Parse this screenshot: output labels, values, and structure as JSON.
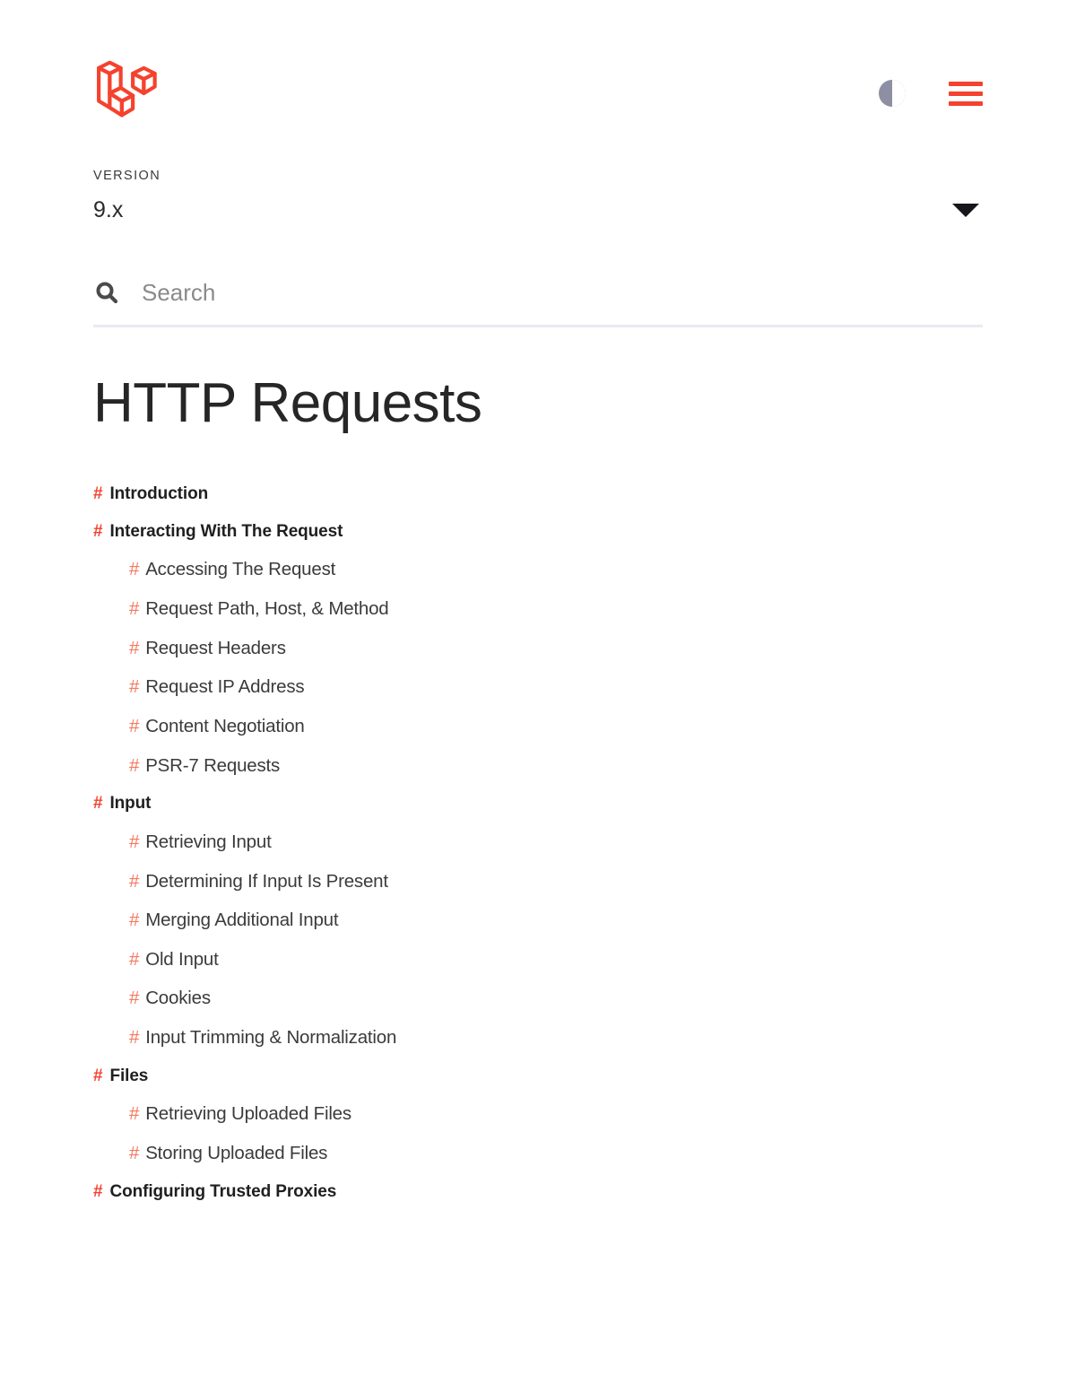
{
  "header": {
    "logo_name": "laravel-logo",
    "logo_color": "#f4422e",
    "dark_mode_toggle_name": "contrast-icon",
    "menu_toggle_name": "hamburger-menu-icon",
    "accent_color": "#f4422e"
  },
  "version": {
    "label": "VERSION",
    "selected": "9.x",
    "caret_name": "chevron-down-icon"
  },
  "search": {
    "placeholder": "Search",
    "value": "",
    "icon_name": "search-icon"
  },
  "main": {
    "title": "HTTP Requests",
    "toc": [
      {
        "label": "Introduction",
        "level": 1
      },
      {
        "label": "Interacting With The Request",
        "level": 1
      },
      {
        "label": "Accessing The Request",
        "level": 2
      },
      {
        "label": "Request Path, Host, & Method",
        "level": 2
      },
      {
        "label": "Request Headers",
        "level": 2
      },
      {
        "label": "Request IP Address",
        "level": 2
      },
      {
        "label": "Content Negotiation",
        "level": 2
      },
      {
        "label": "PSR-7 Requests",
        "level": 2
      },
      {
        "label": "Input",
        "level": 1
      },
      {
        "label": "Retrieving Input",
        "level": 2
      },
      {
        "label": "Determining If Input Is Present",
        "level": 2
      },
      {
        "label": "Merging Additional Input",
        "level": 2
      },
      {
        "label": "Old Input",
        "level": 2
      },
      {
        "label": "Cookies",
        "level": 2
      },
      {
        "label": "Input Trimming & Normalization",
        "level": 2
      },
      {
        "label": "Files",
        "level": 1
      },
      {
        "label": "Retrieving Uploaded Files",
        "level": 2
      },
      {
        "label": "Storing Uploaded Files",
        "level": 2
      },
      {
        "label": "Configuring Trusted Proxies",
        "level": 1
      }
    ],
    "hash_symbol": "#"
  }
}
